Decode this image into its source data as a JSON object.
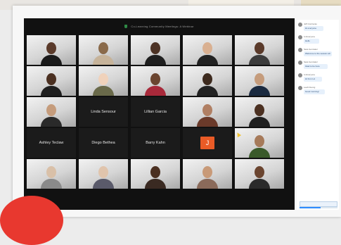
{
  "meeting": {
    "title": "Co-Learning Community Meetings: A Webinar",
    "accent_color": "#2d8cff",
    "tiles": [
      {
        "kind": "video",
        "label": "",
        "skin": "#5a3a2a",
        "shirt": "#1a1a1a"
      },
      {
        "kind": "video",
        "label": "",
        "skin": "#8a6a4a",
        "shirt": "#c6b39a"
      },
      {
        "kind": "video",
        "label": "",
        "skin": "#4d3325",
        "shirt": "#1f1f1f"
      },
      {
        "kind": "video",
        "label": "",
        "skin": "#d9b091",
        "shirt": "#222222"
      },
      {
        "kind": "video",
        "label": "",
        "skin": "#5a3a2a",
        "shirt": "#3c3c3c"
      },
      {
        "kind": "video",
        "label": "",
        "skin": "#4b3021",
        "shirt": "#1f1f1f"
      },
      {
        "kind": "video",
        "label": "",
        "skin": "#f0d2bb",
        "shirt": "#6a6a4a"
      },
      {
        "kind": "video",
        "label": "",
        "skin": "#6b4530",
        "shirt": "#a8293a"
      },
      {
        "kind": "video",
        "label": "",
        "skin": "#3d2a1e",
        "shirt": "#222222"
      },
      {
        "kind": "video",
        "label": "",
        "skin": "#c59c7c",
        "shirt": "#1a2a40"
      },
      {
        "kind": "video",
        "label": "",
        "skin": "#c59c7c",
        "shirt": "#2a2a2a"
      },
      {
        "kind": "name",
        "label": "Linda Sensour"
      },
      {
        "kind": "name",
        "label": "Lillian Garcia"
      },
      {
        "kind": "video",
        "label": "",
        "skin": "#b07f63",
        "shirt": "#6a3a2a"
      },
      {
        "kind": "video",
        "label": "",
        "skin": "#4b3021",
        "shirt": "#1f1f1f"
      },
      {
        "kind": "name",
        "label": "Ashley Teclaw"
      },
      {
        "kind": "name",
        "label": "Diego Bethea"
      },
      {
        "kind": "name",
        "label": "Barry Kahn"
      },
      {
        "kind": "initial",
        "label": "J"
      },
      {
        "kind": "video",
        "label": "",
        "skin": "#a67a5a",
        "shirt": "#3a5a2a"
      },
      {
        "kind": "video",
        "label": "",
        "skin": "#d9c0a8",
        "shirt": "#8a8a8a"
      },
      {
        "kind": "video",
        "label": "",
        "skin": "#e0c4ac",
        "shirt": "#5a5a6a"
      },
      {
        "kind": "video",
        "label": "",
        "skin": "#4b3021",
        "shirt": "#3a2a22"
      },
      {
        "kind": "video",
        "label": "",
        "skin": "#c89a78",
        "shirt": "#8a6a5a"
      },
      {
        "kind": "video",
        "label": "",
        "skin": "#6b4530",
        "shirt": "#2a2a2a"
      }
    ]
  },
  "chat": {
    "messages": [
      {
        "sender": "Jeff Contreras",
        "text": "Hi everyone"
      },
      {
        "sender": "to Everyone",
        "text": "Hello"
      },
      {
        "sender": "Sara Gonzalez",
        "text": "Welcome to the session all"
      },
      {
        "sender": "Sara Gonzalez",
        "text": "Glad to be here"
      },
      {
        "sender": "to Everyone",
        "text": "Hi from LA"
      },
      {
        "sender": "Leah Duong",
        "text": "Good morning!"
      }
    ],
    "progress": 0.55
  }
}
